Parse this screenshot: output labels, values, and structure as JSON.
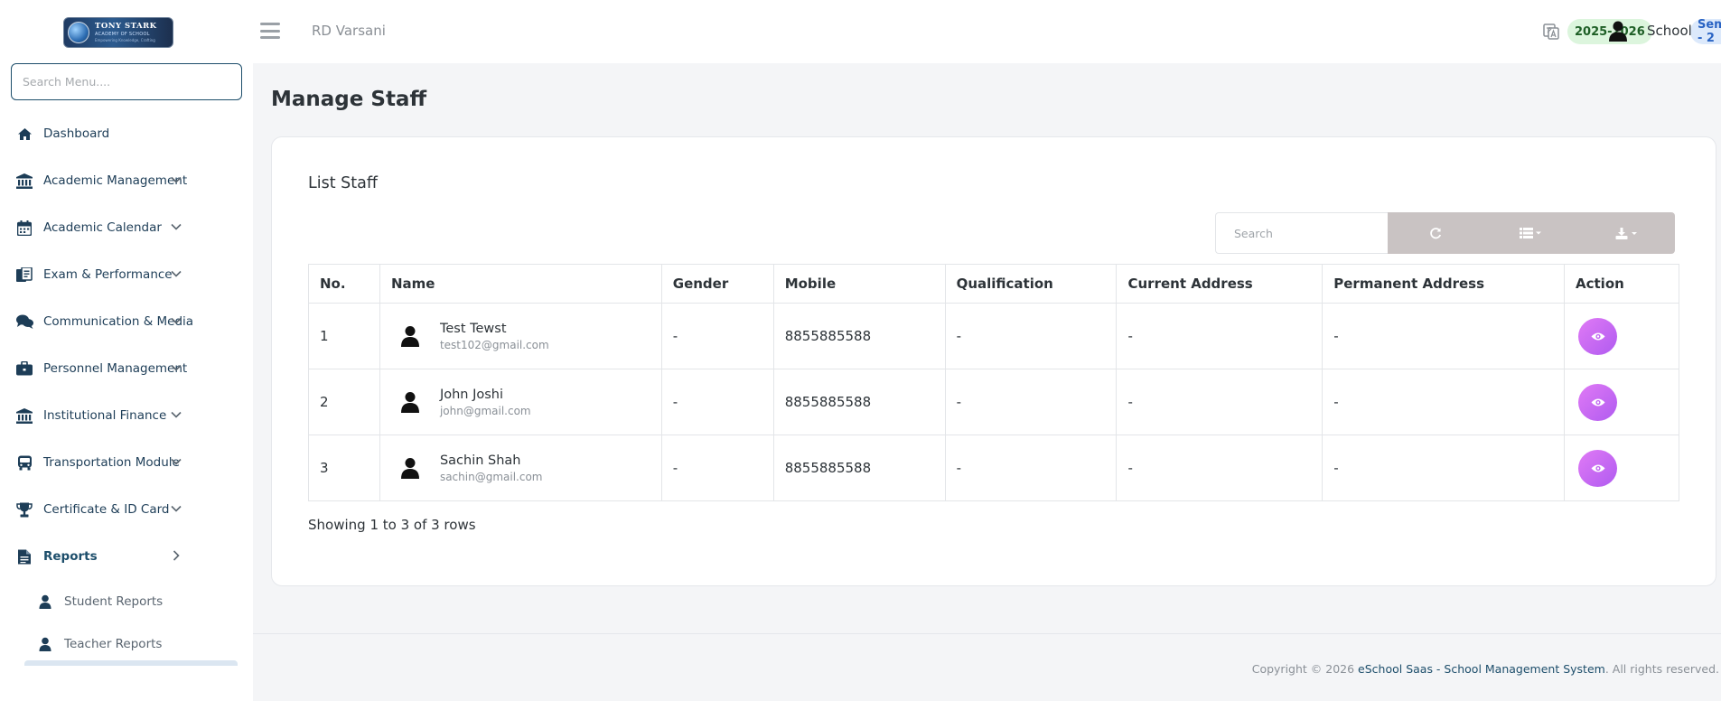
{
  "sidebar": {
    "logo": {
      "line1": "TONY STARK",
      "line2": "ACADEMY OF SCHOOL",
      "line3": "Empowering Knowledge, Crafting"
    },
    "search_placeholder": "Search Menu....",
    "items": [
      {
        "label": "Dashboard",
        "icon": "home-icon"
      },
      {
        "label": "Academic Management",
        "icon": "bank-icon"
      },
      {
        "label": "Academic Calendar",
        "icon": "calendar-icon"
      },
      {
        "label": "Exam & Performance",
        "icon": "document-icon"
      },
      {
        "label": "Communication & Media",
        "icon": "comments-icon"
      },
      {
        "label": "Personnel Management",
        "icon": "briefcase-icon"
      },
      {
        "label": "Institutional Finance",
        "icon": "bank-icon"
      },
      {
        "label": "Transportation Module",
        "icon": "bus-icon"
      },
      {
        "label": "Certificate & ID Card",
        "icon": "trophy-icon"
      },
      {
        "label": "Reports",
        "icon": "file-icon"
      }
    ],
    "sub_items": [
      {
        "label": "Student Reports",
        "icon": "user-icon"
      },
      {
        "label": "Teacher Reports",
        "icon": "user-icon"
      }
    ]
  },
  "header": {
    "school_name": "RD Varsani",
    "session_year": "2025-2026",
    "semester": "Sem - 2",
    "user_label": "School"
  },
  "page": {
    "title": "Manage Staff",
    "card_title": "List Staff",
    "search_placeholder": "Search",
    "columns": [
      "No.",
      "Name",
      "Gender",
      "Mobile",
      "Qualification",
      "Current Address",
      "Permanent Address",
      "Action"
    ],
    "rows": [
      {
        "no": "1",
        "name": "Test Tewst",
        "email": "test102@gmail.com",
        "gender": "-",
        "mobile": "8855885588",
        "qualification": "-",
        "current_address": "-",
        "permanent_address": "-"
      },
      {
        "no": "2",
        "name": "John Joshi",
        "email": "john@gmail.com",
        "gender": "-",
        "mobile": "8855885588",
        "qualification": "-",
        "current_address": "-",
        "permanent_address": "-"
      },
      {
        "no": "3",
        "name": "Sachin Shah",
        "email": "sachin@gmail.com",
        "gender": "-",
        "mobile": "8855885588",
        "qualification": "-",
        "current_address": "-",
        "permanent_address": "-"
      }
    ],
    "pagination_text": "Showing 1 to 3 of 3 rows"
  },
  "footer": {
    "prefix": "Copyright © 2026 ",
    "link": "eSchool Saas - School Management System",
    "suffix": ". All rights reserved."
  },
  "colors": {
    "brand": "#1d4e6b",
    "view_button": "#c167f2",
    "year_badge_bg": "#dcf5dd",
    "sem_badge_bg": "#dce9fb"
  }
}
